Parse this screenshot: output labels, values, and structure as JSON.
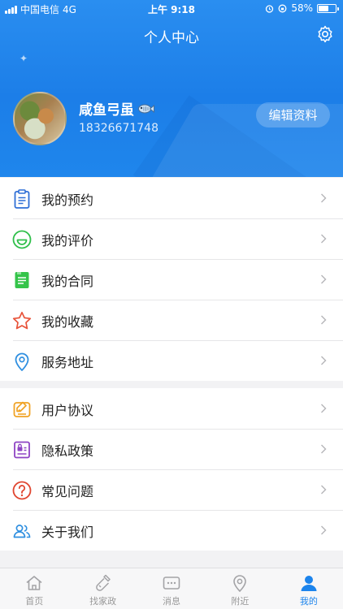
{
  "status_bar": {
    "carrier": "中国电信",
    "network": "4G",
    "time": "上午 9:18",
    "battery": "58%",
    "battery_level": 0.58
  },
  "header": {
    "title": "个人中心",
    "settings_icon": "gear-icon"
  },
  "profile": {
    "username": "咸鱼弓虽",
    "username_badge_icon": "fish-icon",
    "phone": "18326671748",
    "edit_label": "编辑资料"
  },
  "menu_group_1": [
    {
      "label": "我的预约",
      "icon": "clipboard-icon",
      "color": "#2f6fd6"
    },
    {
      "label": "我的评价",
      "icon": "smile-icon",
      "color": "#2fbf4a"
    },
    {
      "label": "我的合同",
      "icon": "contract-icon",
      "color": "#35c44a"
    },
    {
      "label": "我的收藏",
      "icon": "star-icon",
      "color": "#e8533a"
    },
    {
      "label": "服务地址",
      "icon": "location-icon",
      "color": "#2f8fe0"
    }
  ],
  "menu_group_2": [
    {
      "label": "用户协议",
      "icon": "agreement-icon",
      "color": "#f0a326"
    },
    {
      "label": "隐私政策",
      "icon": "privacy-icon",
      "color": "#8e44c4"
    },
    {
      "label": "常见问题",
      "icon": "question-icon",
      "color": "#e0452f"
    },
    {
      "label": "关于我们",
      "icon": "people-icon",
      "color": "#2f8fe0"
    }
  ],
  "tabbar": [
    {
      "label": "首页",
      "icon": "home-icon",
      "active": false
    },
    {
      "label": "找家政",
      "icon": "cleaning-icon",
      "active": false
    },
    {
      "label": "消息",
      "icon": "message-icon",
      "active": false
    },
    {
      "label": "附近",
      "icon": "nearby-icon",
      "active": false
    },
    {
      "label": "我的",
      "icon": "profile-icon",
      "active": true
    }
  ],
  "colors": {
    "header_blue": "#1c7ee8",
    "active_tab": "#1c84ec",
    "inactive_tab": "#999999"
  }
}
